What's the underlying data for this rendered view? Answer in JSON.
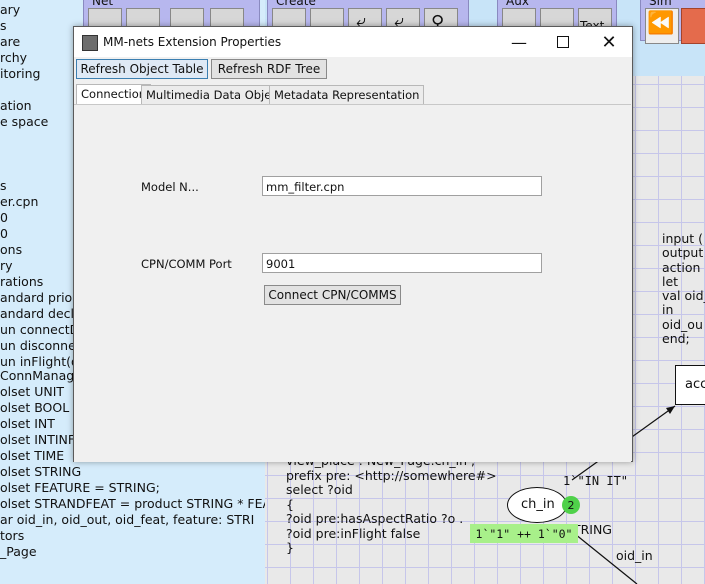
{
  "index_lines": [
    "ary",
    "s",
    "are",
    "rchy",
    "itoring",
    "",
    "ation",
    "e space",
    "",
    "",
    "",
    "s",
    "er.cpn",
    "  0",
    "  0",
    "ons",
    "ry",
    "rations",
    "andard priori",
    "andard decla",
    "un connectD",
    "un disconne",
    "un inFlight(o",
    "ConnManage",
    "olset UNIT",
    "olset BOOL",
    "olset INT",
    "olset INTINF",
    "olset TIME",
    "olset STRING",
    "olset FEATURE = STRING;",
    "olset STRANDFEAT = product STRING * FEA",
    "ar oid_in, oid_out, oid_feat, feature: STRI",
    "tors",
    "_Page"
  ],
  "palettes": {
    "net": "Net",
    "create": "Create",
    "aux": "Aux",
    "sim": "Sim"
  },
  "aux_text_tool": "Text",
  "net_code": [
    "input (",
    "output",
    "action",
    "let",
    "val oid_",
    "in",
    "oid_ou",
    "end;"
  ],
  "transition_label": "acc",
  "place": {
    "name": "ch_in",
    "token_count": "2",
    "marking": "1`\"1\" ++ 1`\"0\"",
    "type": "STRING"
  },
  "arc_label_in": "1`\"IN IT\"",
  "arc_label_out": "oid_in",
  "query_lines": [
    "view_place : New_Page.ch_in ;",
    "prefix pre: <http://somewhere#>",
    "select ?oid",
    "{",
    "?oid pre:hasAspectRatio ?o .",
    "?oid pre:inFlight false",
    "}"
  ],
  "dialog": {
    "title": "MM-nets Extension Properties",
    "buttons": {
      "refresh_object_table": "Refresh Object Table",
      "refresh_rdf_tree": "Refresh RDF Tree"
    },
    "tabs": [
      "Connection",
      "Multimedia Data Objects",
      "Metadata Representation"
    ],
    "active_tab": "Connection",
    "model_label": "Model N...",
    "model_value": "mm_filter.cpn",
    "port_label": "CPN/COMM Port",
    "port_value": "9001",
    "connect_button": "Connect CPN/COMMS"
  }
}
